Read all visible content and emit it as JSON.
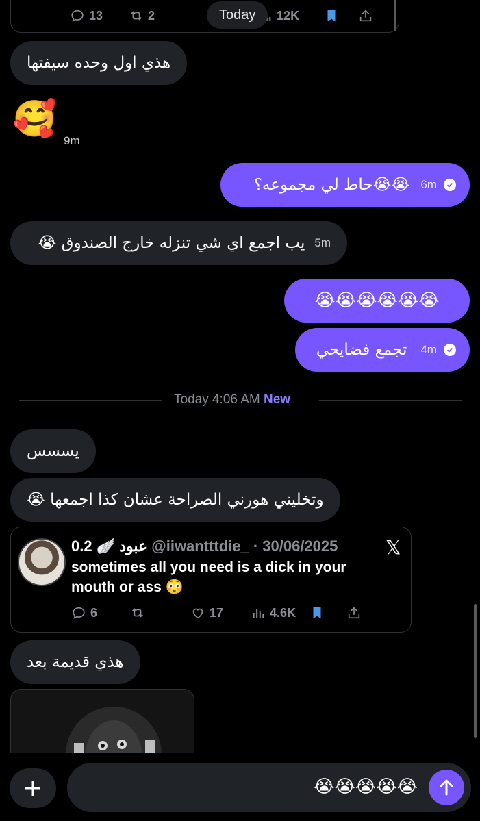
{
  "top_tweet": {
    "replies": "13",
    "reposts": "2",
    "views": "12K"
  },
  "date_pill": "Today",
  "messages": [
    {
      "text": "هذي اول وحده سيفتها",
      "time": ""
    },
    {
      "text": "🥰",
      "time": "9m"
    },
    {
      "text": "😭😭حاط لي مجموعه؟",
      "time": "6m"
    },
    {
      "text": "يب اجمع اي شي تنزله خارج الصندوق 😭",
      "time": "5m"
    },
    {
      "text": "😭😭😭😭😭😭",
      "time": ""
    },
    {
      "text": "تجمع فضايحي",
      "time": "4m"
    },
    {
      "text": "يسسس",
      "time": ""
    },
    {
      "text": "وتخليني هورني الصراحة عشان كذا اجمعها 😭",
      "time": ""
    },
    {
      "text": "هذي قديمة بعد",
      "time": ""
    }
  ],
  "divider": {
    "text": "Today 4:06 AM",
    "badge": "New"
  },
  "quoted_tweet": {
    "display_name": "0.2 🪽 عبود",
    "handle": "@iiwantttdie_ · 30/06/2025",
    "text": "sometimes all you need is a dick in your mouth or ass 😳",
    "replies": "6",
    "reposts": "",
    "likes": "17",
    "views": "4.6K",
    "logo": "𝕏"
  },
  "composer": {
    "value": "😭😭😭😭😭"
  },
  "colors": {
    "accent": "#7856ff",
    "incoming": "#202327",
    "background": "#000000",
    "bookmark": "#4a99e9"
  }
}
